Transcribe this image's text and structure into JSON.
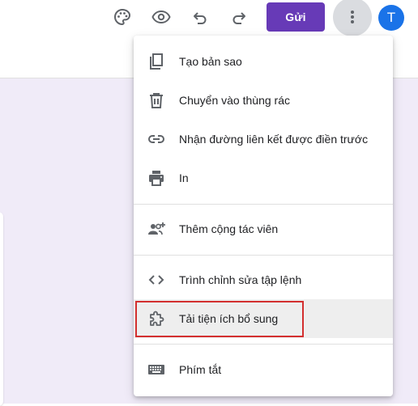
{
  "toolbar": {
    "palette_icon": "palette-icon",
    "preview_icon": "eye-icon",
    "undo_icon": "undo-icon",
    "redo_icon": "redo-icon",
    "send_label": "Gửi",
    "more_icon": "more-vert-icon",
    "avatar_initial": "T"
  },
  "colors": {
    "send_button": "#673ab7",
    "avatar": "#1a73e8",
    "page_background": "#f0ebf8",
    "highlight_border": "#d32f2f"
  },
  "menu": {
    "items": [
      {
        "label": "Tạo bản sao",
        "icon": "copy-icon"
      },
      {
        "label": "Chuyển vào thùng rác",
        "icon": "trash-icon"
      },
      {
        "label": "Nhận đường liên kết được điền trước",
        "icon": "link-icon"
      },
      {
        "label": "In",
        "icon": "print-icon"
      },
      {
        "label": "Thêm cộng tác viên",
        "icon": "add-people-icon"
      },
      {
        "label": "Trình chỉnh sửa tập lệnh",
        "icon": "code-icon"
      },
      {
        "label": "Tải tiện ích bổ sung",
        "icon": "puzzle-icon",
        "highlighted": true
      },
      {
        "label": "Phím tắt",
        "icon": "keyboard-icon"
      }
    ]
  }
}
